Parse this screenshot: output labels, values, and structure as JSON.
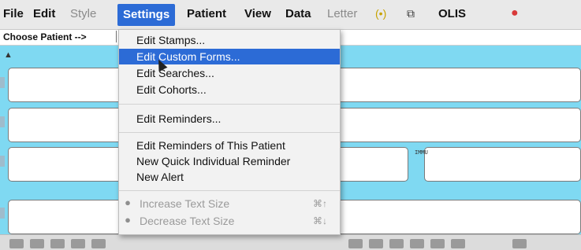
{
  "menubar": {
    "items": [
      {
        "label": "File",
        "state": "normal"
      },
      {
        "label": "Edit",
        "state": "normal"
      },
      {
        "label": "Style",
        "state": "dim"
      },
      {
        "label": "Settings",
        "state": "active"
      },
      {
        "label": "Patient",
        "state": "normal"
      },
      {
        "label": "View",
        "state": "normal"
      },
      {
        "label": "Data",
        "state": "normal"
      },
      {
        "label": "Letter",
        "state": "dim"
      }
    ],
    "icons": [
      "wifi-signal-icon",
      "external-link-icon",
      "speech-bubble-icon"
    ],
    "olis_label": "OLIS"
  },
  "patient_strip": {
    "label": "Choose Patient -->"
  },
  "panels": {
    "immu_label": "IMMU"
  },
  "settings_menu": {
    "items": [
      {
        "label": "Edit Stamps..."
      },
      {
        "label": "Edit Custom Forms...",
        "highlighted": true
      },
      {
        "label": "Edit Searches..."
      },
      {
        "label": "Edit Cohorts..."
      },
      {
        "label": "Edit Reminders..."
      },
      {
        "label": "Edit Reminders of This Patient"
      },
      {
        "label": "New Quick Individual Reminder"
      },
      {
        "label": "New Alert"
      },
      {
        "label": "Increase Text Size",
        "shortcut": "⌘↑",
        "disabled": true
      },
      {
        "label": "Decrease Text Size",
        "shortcut": "⌘↓",
        "disabled": true
      }
    ]
  },
  "colors": {
    "accent": "#2c6bd6",
    "workspace": "#7fd9f2",
    "menubar": "#e9e9e9"
  }
}
